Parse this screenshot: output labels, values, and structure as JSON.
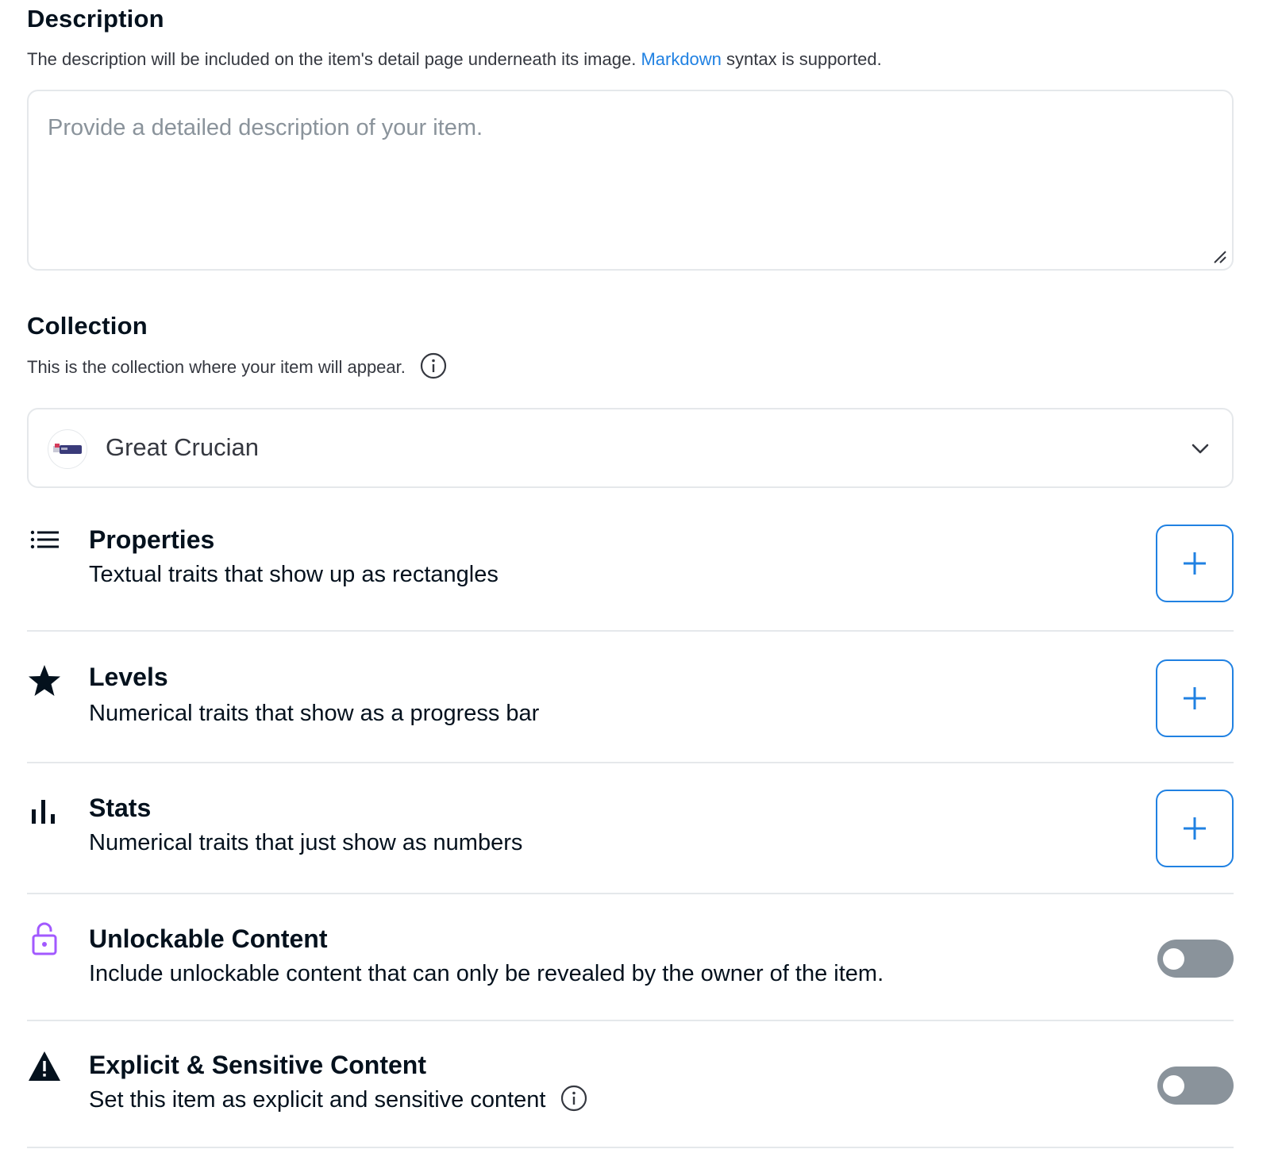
{
  "description": {
    "title": "Description",
    "subtitle_before": "The description will be included on the item's detail page underneath its image. ",
    "subtitle_link": "Markdown",
    "subtitle_after": " syntax is supported.",
    "placeholder": "Provide a detailed description of your item.",
    "value": ""
  },
  "collection": {
    "title": "Collection",
    "subtitle": "This is the collection where your item will appear.",
    "selected": "Great Crucian"
  },
  "traits": [
    {
      "icon": "list-icon",
      "title": "Properties",
      "description": "Textual traits that show up as rectangles",
      "action": "add"
    },
    {
      "icon": "star-icon",
      "title": "Levels",
      "description": "Numerical traits that show as a progress bar",
      "action": "add"
    },
    {
      "icon": "bar-chart-icon",
      "title": "Stats",
      "description": "Numerical traits that just show as numbers",
      "action": "add"
    }
  ],
  "toggles": [
    {
      "icon": "lock-icon",
      "title": "Unlockable Content",
      "description": "Include unlockable content that can only be revealed by the owner of the item.",
      "enabled": false
    },
    {
      "icon": "warning-icon",
      "title": "Explicit & Sensitive Content",
      "description": "Set this item as explicit and sensitive content",
      "enabled": false
    }
  ],
  "colors": {
    "accent": "#2081e2",
    "text": "#04111d",
    "muted": "#8a939b",
    "border": "#e5e8eb",
    "lock": "#a259ff"
  }
}
